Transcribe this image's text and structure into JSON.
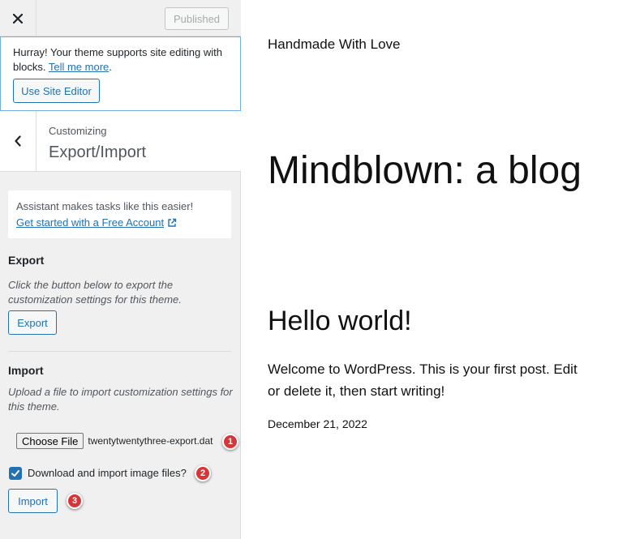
{
  "topbar": {
    "close_icon": "close-icon",
    "published_label": "Published"
  },
  "notice": {
    "text": "Hurray! Your theme supports site editing with blocks. ",
    "link": "Tell me more",
    "suffix": ".",
    "button_label": "Use Site Editor"
  },
  "section": {
    "back_icon": "chevron-left-icon",
    "customizing_label": "Customizing",
    "title": "Export/Import"
  },
  "assistant": {
    "text": "Assistant makes tasks like this easier!",
    "link": "Get started with a Free Account",
    "link_icon": "external-link-icon"
  },
  "export": {
    "heading": "Export",
    "description": "Click the button below to export the customization settings for this theme.",
    "button_label": "Export"
  },
  "import": {
    "heading": "Import",
    "description": "Upload a file to import customization settings for this theme.",
    "choose_file_label": "Choose File",
    "file_name": "twentytwentythree-export.dat",
    "checkbox_checked": true,
    "checkbox_label": "Download and import image files?",
    "button_label": "Import"
  },
  "annotations": {
    "badge_1": "1",
    "badge_2": "2",
    "badge_3": "3",
    "badge_color": "#d63638"
  },
  "preview": {
    "tagline": "Handmade With Love",
    "site_title": "Mindblown: a blog",
    "post_title": "Hello world!",
    "post_excerpt": "Welcome to WordPress. This is your first post. Edit or delete it, then start writing!",
    "post_date": "December 21, 2022"
  },
  "colors": {
    "accent": "#2271b1",
    "sidebar_bg": "#f0f0f1",
    "notice_border": "#72aee6"
  }
}
